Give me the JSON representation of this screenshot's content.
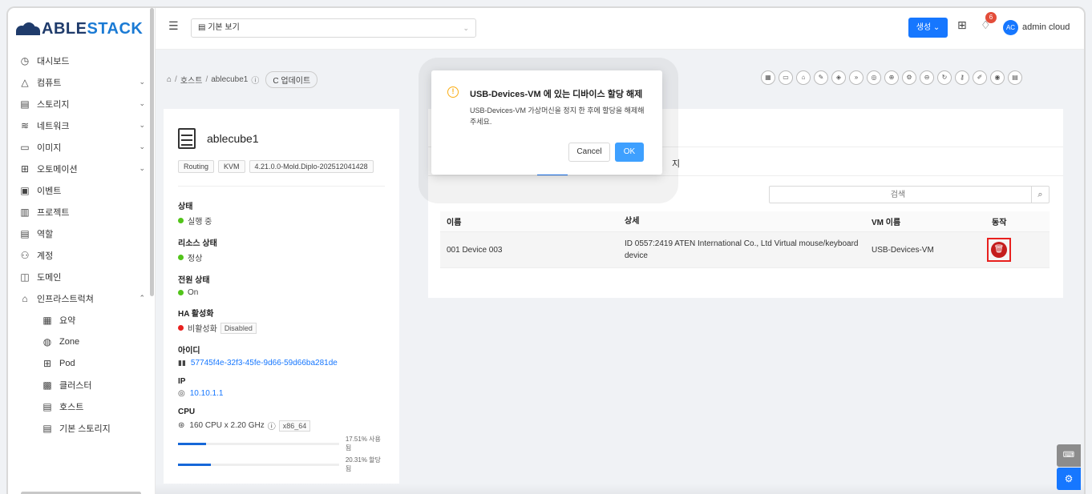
{
  "brand": {
    "able": "ABLE",
    "stack": "STACK"
  },
  "sidebar": {
    "items": [
      {
        "icon": "◷",
        "label": "대시보드",
        "chevron": ""
      },
      {
        "icon": "△",
        "label": "컴퓨트",
        "chevron": "⌄"
      },
      {
        "icon": "▤",
        "label": "스토리지",
        "chevron": "⌄"
      },
      {
        "icon": "≋",
        "label": "네트워크",
        "chevron": "⌄"
      },
      {
        "icon": "▭",
        "label": "이미지",
        "chevron": "⌄"
      },
      {
        "icon": "⊞",
        "label": "오토메이션",
        "chevron": "⌄"
      },
      {
        "icon": "▣",
        "label": "이벤트",
        "chevron": ""
      },
      {
        "icon": "▥",
        "label": "프로젝트",
        "chevron": ""
      },
      {
        "icon": "▤",
        "label": "역할",
        "chevron": ""
      },
      {
        "icon": "⚇",
        "label": "계정",
        "chevron": ""
      },
      {
        "icon": "◫",
        "label": "도메인",
        "chevron": ""
      },
      {
        "icon": "⌂",
        "label": "인프라스트럭쳐",
        "chevron": "⌃"
      }
    ],
    "subitems": [
      {
        "icon": "▦",
        "label": "요약"
      },
      {
        "icon": "◍",
        "label": "Zone"
      },
      {
        "icon": "⊞",
        "label": "Pod"
      },
      {
        "icon": "▩",
        "label": "클러스터"
      },
      {
        "icon": "▤",
        "label": "호스트"
      },
      {
        "icon": "▤",
        "label": "기본 스토리지"
      }
    ]
  },
  "topbar": {
    "toggle_icon": "☰",
    "view_select": "▤ 기본 보기",
    "create_label": "생성 ⌄",
    "notification_count": "6",
    "avatar_initials": "AC",
    "username": "admin cloud"
  },
  "breadcrumb": {
    "home": "⌂",
    "hosts": "호스트",
    "current": "ablecube1",
    "update_label": "C 업데이트"
  },
  "host": {
    "name": "ablecube1",
    "tags": [
      "Routing",
      "KVM",
      "4.21.0.0-Mold.Diplo-202512041428"
    ],
    "state_label": "상태",
    "state_value": "실행 중",
    "resource_state_label": "리소스 상태",
    "resource_state_value": "정상",
    "power_state_label": "전원 상태",
    "power_state_value": "On",
    "ha_label": "HA 활성화",
    "ha_value": "비활성화",
    "ha_tag": "Disabled",
    "id_label": "아이디",
    "id_value": "57745f4e-32f3-45fe-9d66-59d66ba281de",
    "ip_label": "IP",
    "ip_value": "10.10.1.1",
    "cpu_label": "CPU",
    "cpu_value": "160 CPU x 2.20 GHz",
    "cpu_arch": "x86_64",
    "cpu_used_pct": 17.51,
    "cpu_used_text": "17.51% 사용됨",
    "cpu_alloc_pct": 20.31,
    "cpu_alloc_text": "20.31% 할당됨"
  },
  "devices": {
    "tab_partial": "지",
    "search_placeholder": "검색",
    "columns": [
      "이름",
      "상세",
      "VM 이름",
      "동작"
    ],
    "rows": [
      {
        "name": "001 Device 003",
        "detail": "ID 0557:2419 ATEN International Co., Ltd Virtual mouse/keyboard device",
        "vm": "USB-Devices-VM"
      }
    ]
  },
  "modal": {
    "title": "USB-Devices-VM 에 있는 디바이스 할당 해제",
    "body": "USB-Devices-VM 가상머신을 정지 한 후에 할당을 해제해주세요.",
    "cancel_label": "Cancel",
    "ok_label": "OK"
  },
  "colors": {
    "primary": "#1677ff",
    "danger": "#c41d1d",
    "warning": "#faad14",
    "success": "#52c41a"
  }
}
